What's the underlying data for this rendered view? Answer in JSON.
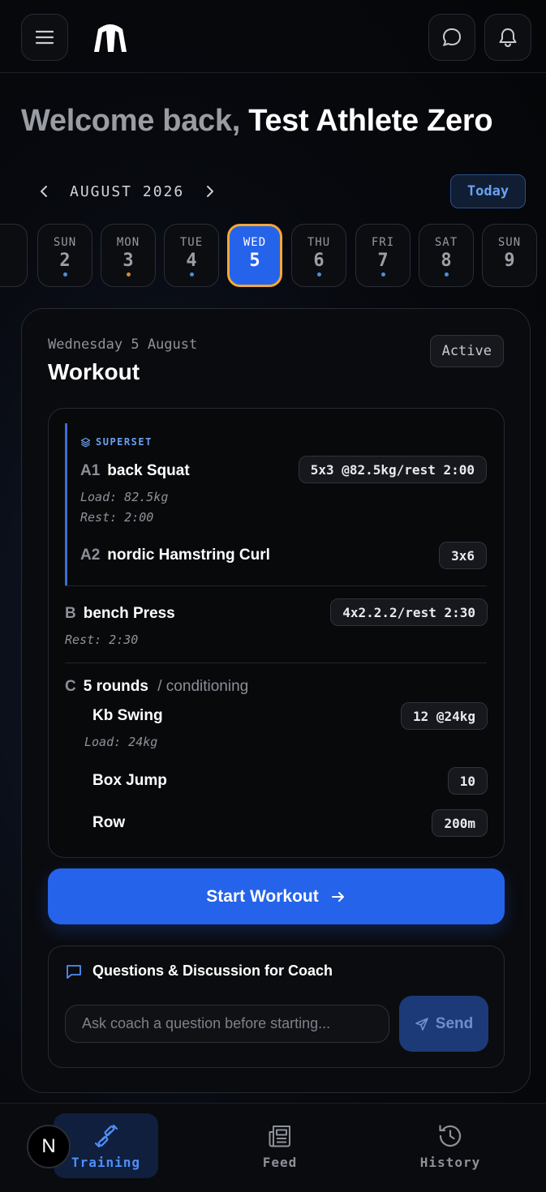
{
  "welcome": {
    "prefix": "Welcome back,",
    "name": "Test Athlete Zero"
  },
  "calendar": {
    "month_label": "AUGUST 2026",
    "today_label": "Today",
    "days": [
      {
        "name": "SUN",
        "num": "2",
        "dot": "#4a8fd8"
      },
      {
        "name": "MON",
        "num": "3",
        "dot": "#d38a2c"
      },
      {
        "name": "TUE",
        "num": "4",
        "dot": "#4a8fd8"
      },
      {
        "name": "WED",
        "num": "5",
        "dot": ""
      },
      {
        "name": "THU",
        "num": "6",
        "dot": "#4a8fd8"
      },
      {
        "name": "FRI",
        "num": "7",
        "dot": "#4a8fd8"
      },
      {
        "name": "SAT",
        "num": "8",
        "dot": "#4a8fd8"
      },
      {
        "name": "SUN",
        "num": "9",
        "dot": ""
      }
    ]
  },
  "workout": {
    "date": "Wednesday 5 August",
    "title": "Workout",
    "status": "Active",
    "superset_label": "SUPERSET",
    "a1": {
      "code": "A1",
      "name": "back Squat",
      "prescription": "5x3 @82.5kg/rest 2:00",
      "load": "Load: 82.5kg",
      "rest": "Rest: 2:00"
    },
    "a2": {
      "code": "A2",
      "name": "nordic Hamstring Curl",
      "prescription": "3x6"
    },
    "b": {
      "code": "B",
      "name": "bench Press",
      "prescription": "4x2.2.2/rest 2:30",
      "rest": "Rest: 2:30"
    },
    "c": {
      "code": "C",
      "rounds": "5 rounds",
      "type": "/ conditioning",
      "items": [
        {
          "name": "Kb Swing",
          "prescription": "12 @24kg",
          "load": "Load: 24kg"
        },
        {
          "name": "Box Jump",
          "prescription": "10"
        },
        {
          "name": "Row",
          "prescription": "200m"
        }
      ]
    },
    "start_label": "Start Workout"
  },
  "discussion": {
    "title": "Questions & Discussion for Coach",
    "placeholder": "Ask coach a question before starting...",
    "send_label": "Send"
  },
  "nav": {
    "avatar_letter": "N",
    "training": "Training",
    "feed": "Feed",
    "history": "History"
  },
  "colors": {
    "accent": "#2563eb",
    "selected_border": "#f3a73c"
  }
}
